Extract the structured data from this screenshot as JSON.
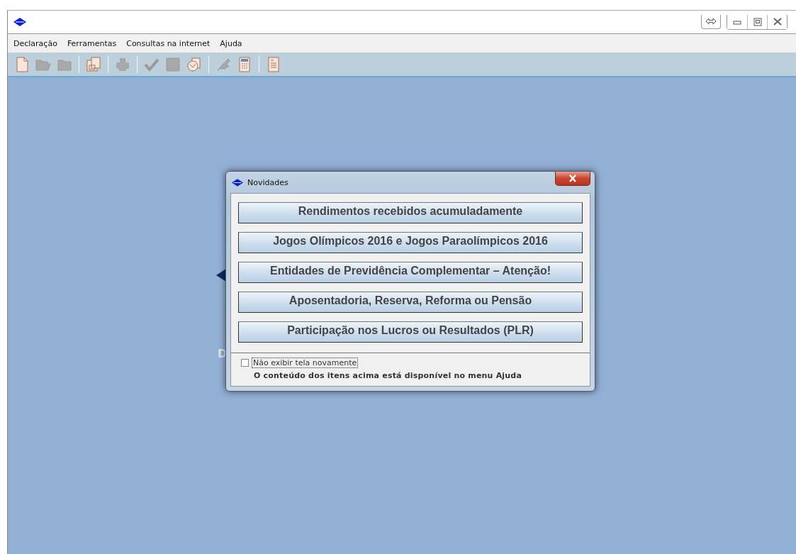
{
  "window": {
    "buttons": [
      {
        "kind": "resize"
      },
      {
        "kind": "minimize"
      },
      {
        "kind": "maximize"
      },
      {
        "kind": "close"
      }
    ]
  },
  "menu": [
    "Declaração",
    "Ferramentas",
    "Consultas na internet",
    "Ajuda"
  ],
  "toolbar": [
    [
      {
        "kind": "new",
        "disabled": false
      },
      {
        "kind": "open",
        "disabled": true
      },
      {
        "kind": "folder",
        "disabled": true
      }
    ],
    [
      {
        "kind": "save",
        "disabled": false
      }
    ],
    [
      {
        "kind": "print",
        "disabled": true
      }
    ],
    [
      {
        "kind": "check",
        "disabled": true
      },
      {
        "kind": "stop",
        "disabled": true
      },
      {
        "kind": "globe",
        "disabled": false
      }
    ],
    [
      {
        "kind": "pen",
        "disabled": true
      },
      {
        "kind": "calculator",
        "disabled": false
      }
    ],
    [
      {
        "kind": "form",
        "disabled": false
      }
    ]
  ],
  "background_fragment": "D",
  "dialog": {
    "title": "Novidades",
    "buttons": [
      "Rendimentos recebidos acumuladamente",
      "Jogos Olímpicos 2016 e Jogos Paraolímpicos 2016",
      "Entidades de Previdência Complementar – Atenção!",
      "Aposentadoria, Reserva, Reforma ou Pensão",
      "Participação nos Lucros ou Resultados (PLR)"
    ],
    "checkbox": {
      "label": "Não exibir tela novamente",
      "checked": false
    },
    "note": "O conteúdo dos itens acima está disponível no menu Ajuda"
  }
}
